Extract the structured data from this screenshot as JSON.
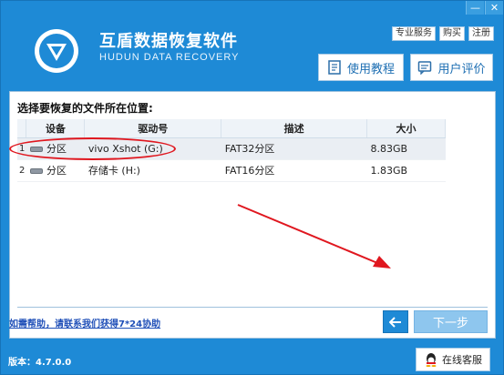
{
  "window": {
    "minimize_label": "—",
    "close_label": "✕"
  },
  "header": {
    "app_title": "互盾数据恢复软件",
    "app_subtitle": "HUDUN DATA RECOVERY",
    "links": [
      "专业服务",
      "购买",
      "注册"
    ],
    "tutorial_label": "使用教程",
    "review_label": "用户评价"
  },
  "main": {
    "section_title": "选择要恢复的文件所在位置:",
    "columns": [
      "设备",
      "驱动号",
      "描述",
      "大小"
    ],
    "rows": [
      {
        "index": "1",
        "device": "分区",
        "drive": "vivo Xshot (G:)",
        "description": "FAT32分区",
        "size": "8.83GB"
      },
      {
        "index": "2",
        "device": "分区",
        "drive": "存储卡 (H:)",
        "description": "FAT16分区",
        "size": "1.83GB"
      }
    ],
    "help_link": "如需帮助，请联系我们获得7*24协助",
    "next_label": "下一步"
  },
  "footer": {
    "version": "版本：4.7.0.0",
    "service_label": "在线客服"
  },
  "colors": {
    "frame": "#1e8ad6",
    "annotation": "#e0171f",
    "next_button": "#8ec6ee"
  }
}
